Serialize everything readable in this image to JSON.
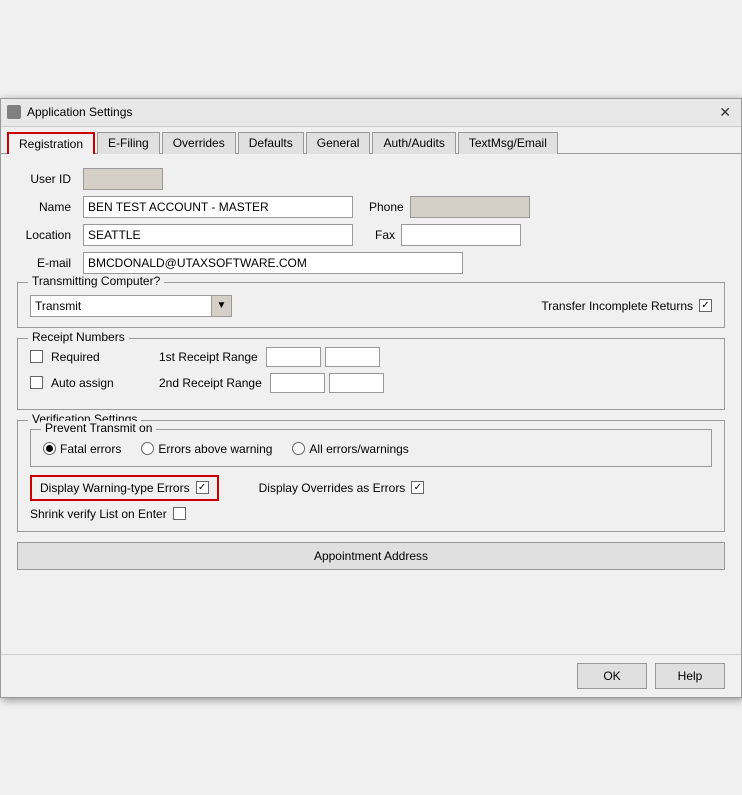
{
  "window": {
    "title": "Application Settings",
    "close_label": "✕"
  },
  "tabs": [
    {
      "label": "Registration",
      "active": true
    },
    {
      "label": "E-Filing",
      "active": false
    },
    {
      "label": "Overrides",
      "active": false
    },
    {
      "label": "Defaults",
      "active": false
    },
    {
      "label": "General",
      "active": false
    },
    {
      "label": "Auth/Audits",
      "active": false
    },
    {
      "label": "TextMsg/Email",
      "active": false
    }
  ],
  "form": {
    "user_id_label": "User ID",
    "user_id_value": "",
    "name_label": "Name",
    "name_value": "BEN TEST ACCOUNT - MASTER",
    "location_label": "Location",
    "location_value": "SEATTLE",
    "email_label": "E-mail",
    "email_value": "BMCDONALD@UTAXSOFTWARE.COM",
    "phone_label": "Phone",
    "phone_value": "",
    "fax_label": "Fax",
    "fax_value": ""
  },
  "transmit_section": {
    "title": "Transmitting Computer?",
    "transmit_label": "Transmit",
    "transfer_label": "Transfer Incomplete Returns",
    "transfer_checked": true
  },
  "receipt_section": {
    "title": "Receipt Numbers",
    "required_label": "Required",
    "required_checked": false,
    "auto_assign_label": "Auto assign",
    "auto_assign_checked": false,
    "first_range_label": "1st Receipt Range",
    "second_range_label": "2nd Receipt Range"
  },
  "verification_section": {
    "title": "Verification Settings",
    "prevent_title": "Prevent Transmit on",
    "radio_options": [
      {
        "label": "Fatal errors",
        "selected": true
      },
      {
        "label": "Errors above warning",
        "selected": false
      },
      {
        "label": "All errors/warnings",
        "selected": false
      }
    ],
    "display_warning_label": "Display Warning-type Errors",
    "display_warning_checked": true,
    "display_overrides_label": "Display Overrides as Errors",
    "display_overrides_checked": true,
    "shrink_verify_label": "Shrink verify List on Enter",
    "shrink_verify_checked": false
  },
  "appointment_button_label": "Appointment Address",
  "buttons": {
    "ok_label": "OK",
    "help_label": "Help"
  }
}
